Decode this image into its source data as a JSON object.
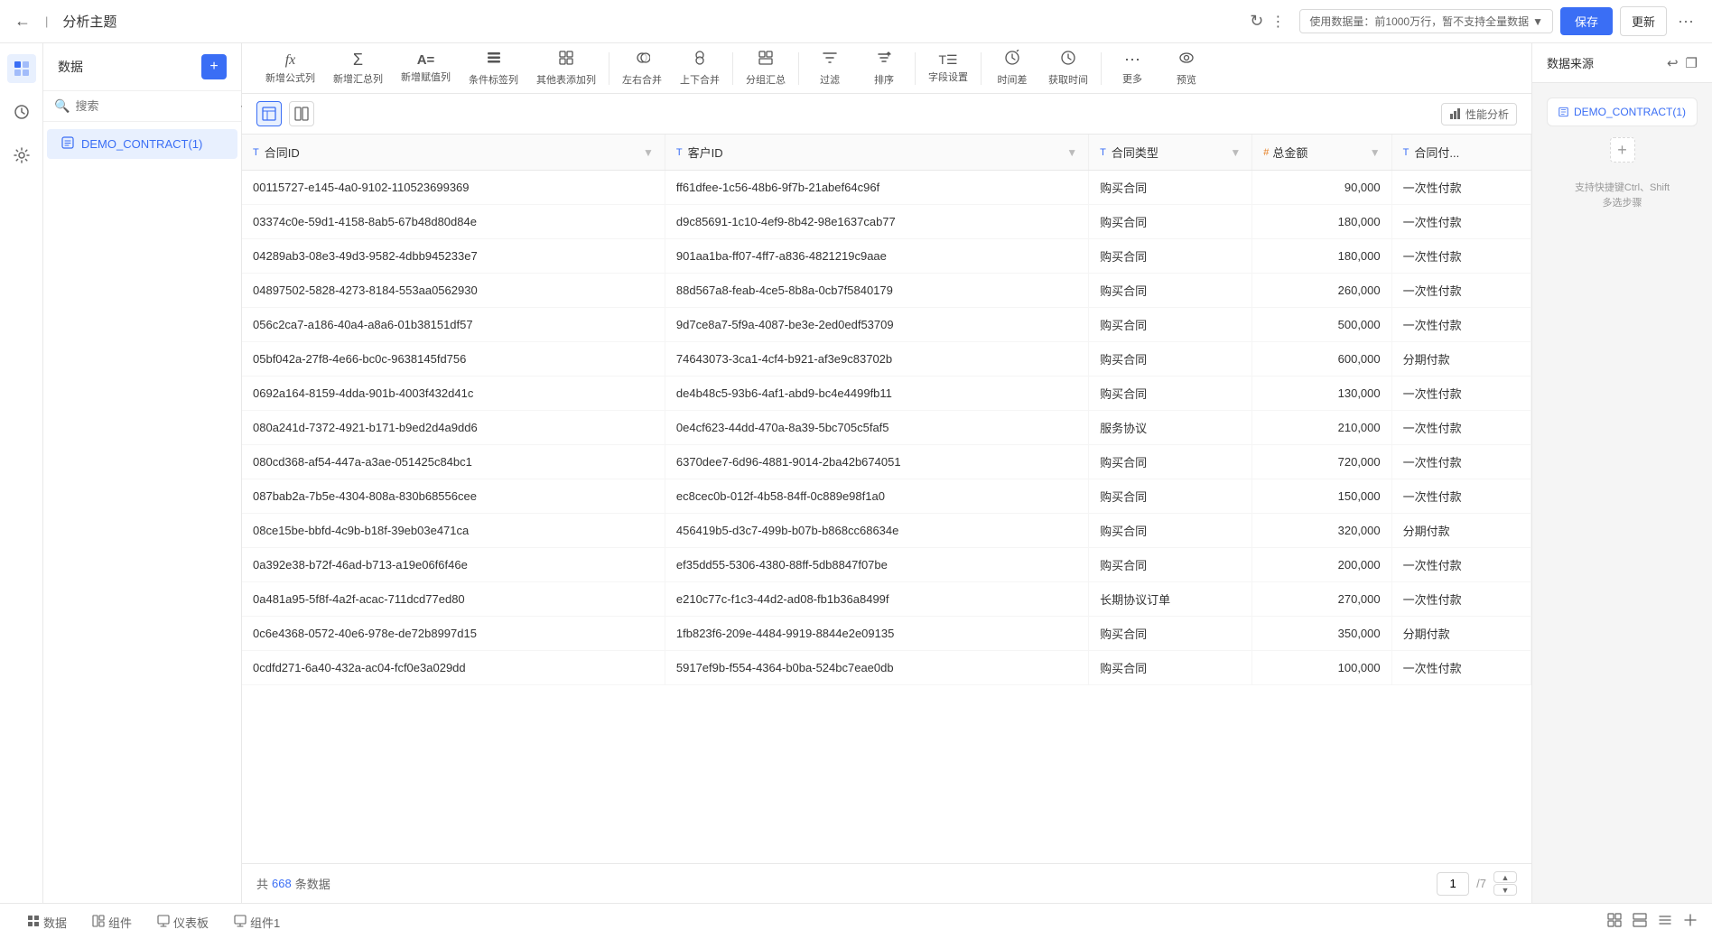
{
  "topbar": {
    "back_icon": "←",
    "title": "分析主题",
    "refresh_icon": "↻",
    "layout_icon": "⊞",
    "data_usage_label": "使用数据量：前1000万行，暂不支持全量数据",
    "data_usage_dropdown": "▾",
    "save_label": "保存",
    "update_label": "更新",
    "more_label": "···"
  },
  "sidebar": {
    "icons": [
      "◧",
      "☰",
      "⊞"
    ]
  },
  "data_panel": {
    "title": "数据",
    "add_icon": "+",
    "search_placeholder": "搜索",
    "more_icon": "···",
    "items": [
      {
        "label": "DEMO_CONTRACT(1)",
        "active": true
      }
    ]
  },
  "toolbar": {
    "items": [
      {
        "icon": "fx",
        "label": "新增公式列"
      },
      {
        "icon": "Σ",
        "label": "新增汇总列"
      },
      {
        "icon": "A=",
        "label": "新增赋值列"
      },
      {
        "icon": "☰+",
        "label": "条件标签列"
      },
      {
        "icon": "⊞+",
        "label": "其他表添加列"
      },
      {
        "icon": "⇔",
        "label": "左右合并"
      },
      {
        "icon": "⇕",
        "label": "上下合并"
      },
      {
        "icon": "⊞⊟",
        "label": "分组汇总"
      },
      {
        "icon": "▽",
        "label": "过滤"
      },
      {
        "icon": "↕",
        "label": "排序"
      },
      {
        "icon": "⊞T",
        "label": "字段设置"
      },
      {
        "icon": "⏱",
        "label": "时间差"
      },
      {
        "icon": "⏰",
        "label": "获取时间"
      },
      {
        "icon": "···",
        "label": "更多"
      },
      {
        "icon": "👁",
        "label": "预览"
      }
    ]
  },
  "view_controls": {
    "table_icon": "⊞",
    "split_icon": "⊟",
    "perf_label": "性能分析"
  },
  "table": {
    "columns": [
      {
        "type": "T",
        "name": "合同ID"
      },
      {
        "type": "T",
        "name": "客户ID"
      },
      {
        "type": "T",
        "name": "合同类型"
      },
      {
        "type": "#",
        "name": "总金额"
      },
      {
        "type": "T",
        "name": "合同付..."
      }
    ],
    "rows": [
      {
        "id": "00115727-e145-4a0-9102-110523699369",
        "customer": "ff61dfee-1c56-48b6-9f7b-21abef64c96f",
        "type": "购买合同",
        "amount": "90,000",
        "payment": "一次性付款"
      },
      {
        "id": "03374c0e-59d1-4158-8ab5-67b48d80d84e",
        "customer": "d9c85691-1c10-4ef9-8b42-98e1637cab77",
        "type": "购买合同",
        "amount": "180,000",
        "payment": "一次性付款"
      },
      {
        "id": "04289ab3-08e3-49d3-9582-4dbb945233e7",
        "customer": "901aa1ba-ff07-4ff7-a836-4821219c9aae",
        "type": "购买合同",
        "amount": "180,000",
        "payment": "一次性付款"
      },
      {
        "id": "04897502-5828-4273-8184-553aa0562930",
        "customer": "88d567a8-feab-4ce5-8b8a-0cb7f5840179",
        "type": "购买合同",
        "amount": "260,000",
        "payment": "一次性付款"
      },
      {
        "id": "056c2ca7-a186-40a4-a8a6-01b38151df57",
        "customer": "9d7ce8a7-5f9a-4087-be3e-2ed0edf53709",
        "type": "购买合同",
        "amount": "500,000",
        "payment": "一次性付款"
      },
      {
        "id": "05bf042a-27f8-4e66-bc0c-9638145fd756",
        "customer": "74643073-3ca1-4cf4-b921-af3e9c83702b",
        "type": "购买合同",
        "amount": "600,000",
        "payment": "分期付款"
      },
      {
        "id": "0692a164-8159-4dda-901b-4003f432d41c",
        "customer": "de4b48c5-93b6-4af1-abd9-bc4e4499fb11",
        "type": "购买合同",
        "amount": "130,000",
        "payment": "一次性付款"
      },
      {
        "id": "080a241d-7372-4921-b171-b9ed2d4a9dd6",
        "customer": "0e4cf623-44dd-470a-8a39-5bc705c5faf5",
        "type": "服务协议",
        "amount": "210,000",
        "payment": "一次性付款"
      },
      {
        "id": "080cd368-af54-447a-a3ae-051425c84bc1",
        "customer": "6370dee7-6d96-4881-9014-2ba42b674051",
        "type": "购买合同",
        "amount": "720,000",
        "payment": "一次性付款"
      },
      {
        "id": "087bab2a-7b5e-4304-808a-830b68556cee",
        "customer": "ec8cec0b-012f-4b58-84ff-0c889e98f1a0",
        "type": "购买合同",
        "amount": "150,000",
        "payment": "一次性付款"
      },
      {
        "id": "08ce15be-bbfd-4c9b-b18f-39eb03e471ca",
        "customer": "456419b5-d3c7-499b-b07b-b868cc68634e",
        "type": "购买合同",
        "amount": "320,000",
        "payment": "分期付款"
      },
      {
        "id": "0a392e38-b72f-46ad-b713-a19e06f6f46e",
        "customer": "ef35dd55-5306-4380-88ff-5db8847f07be",
        "type": "购买合同",
        "amount": "200,000",
        "payment": "一次性付款"
      },
      {
        "id": "0a481a95-5f8f-4a2f-acac-711dcd77ed80",
        "customer": "e210c77c-f1c3-44d2-ad08-fb1b36a8499f",
        "type": "长期协议订单",
        "amount": "270,000",
        "payment": "一次性付款"
      },
      {
        "id": "0c6e4368-0572-40e6-978e-de72b8997d15",
        "customer": "1fb823f6-209e-4484-9919-8844e2e09135",
        "type": "购买合同",
        "amount": "350,000",
        "payment": "分期付款"
      },
      {
        "id": "0cdfd271-6a40-432a-ac04-fcf0e3a029dd",
        "customer": "5917ef9b-f554-4364-b0ba-524bc7eae0db",
        "type": "购买合同",
        "amount": "100,000",
        "payment": "一次性付款"
      }
    ]
  },
  "footer": {
    "total_prefix": "共",
    "total_count": "668",
    "total_suffix": "条数据",
    "current_page": "1",
    "total_pages": "/7",
    "nav_up": "▲",
    "nav_down": "▼"
  },
  "right_panel": {
    "title": "数据来源",
    "undo_icon": "↩",
    "config_icon": "⊞",
    "datasource_label": "DEMO_CONTRACT(1)",
    "add_icon": "+",
    "tip": "支持快捷键Ctrl、Shift\n多选步骤"
  },
  "bottom_tabs": [
    {
      "icon": "☰",
      "label": "数据",
      "active": false
    },
    {
      "icon": "⊞",
      "label": "组件",
      "active": false
    },
    {
      "icon": "⊟",
      "label": "仪表板",
      "active": false
    },
    {
      "icon": "⊟",
      "label": "组件1",
      "active": false
    }
  ],
  "bottom_icons": [
    "⊞",
    "⊟",
    "≡",
    "↩"
  ]
}
